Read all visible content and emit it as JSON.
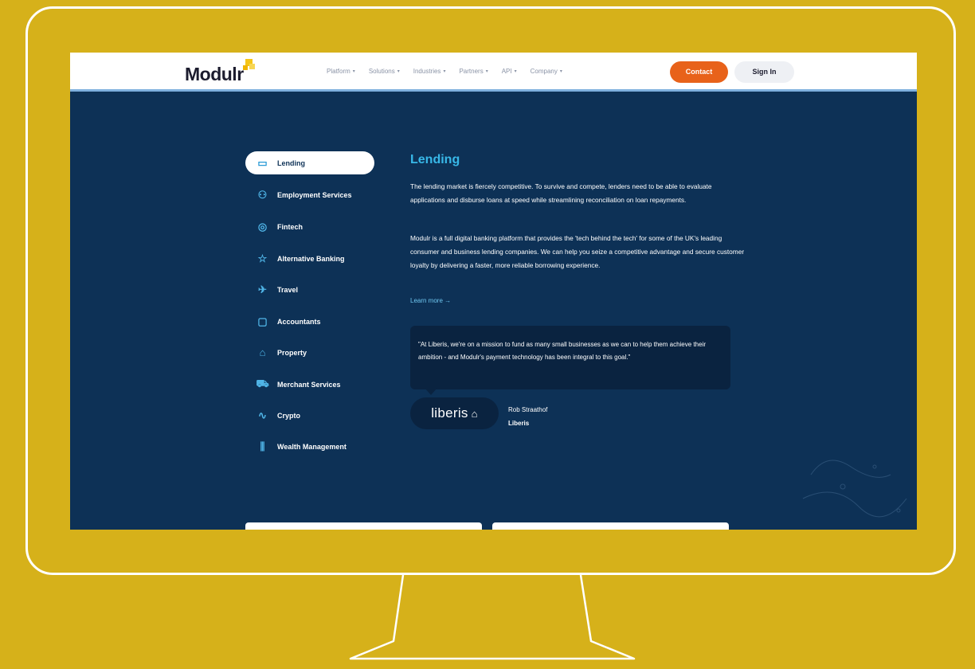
{
  "nav": {
    "logo_text": "Modulr",
    "menu": [
      {
        "label": "Platform"
      },
      {
        "label": "Solutions"
      },
      {
        "label": "Industries"
      },
      {
        "label": "Partners"
      },
      {
        "label": "API"
      },
      {
        "label": "Company"
      }
    ],
    "contact_label": "Contact",
    "signin_label": "Sign In"
  },
  "sidebar": {
    "items": [
      {
        "label": "Lending",
        "icon": "card-icon",
        "glyph": "▭",
        "active": true
      },
      {
        "label": "Employment Services",
        "icon": "person-icon",
        "glyph": "⚇"
      },
      {
        "label": "Fintech",
        "icon": "globe-icon",
        "glyph": "◎"
      },
      {
        "label": "Alternative Banking",
        "icon": "star-icon",
        "glyph": "☆"
      },
      {
        "label": "Travel",
        "icon": "plane-icon",
        "glyph": "✈"
      },
      {
        "label": "Accountants",
        "icon": "tablet-icon",
        "glyph": "▢"
      },
      {
        "label": "Property",
        "icon": "home-icon",
        "glyph": "⌂"
      },
      {
        "label": "Merchant Services",
        "icon": "cart-icon",
        "glyph": "⛟"
      },
      {
        "label": "Crypto",
        "icon": "pulse-icon",
        "glyph": "∿"
      },
      {
        "label": "Wealth Management",
        "icon": "sliders-icon",
        "glyph": "⫼"
      }
    ]
  },
  "content": {
    "title": "Lending",
    "para1": "The lending market is fiercely competitive. To survive and compete, lenders need to be able to evaluate applications and disburse loans at speed while streamlining reconciliation on loan repayments.",
    "para2": "Modulr is a full digital banking platform that provides the 'tech behind the tech' for some of the UK's leading consumer and business lending companies. We can help you seize a competitive advantage and secure customer loyalty by delivering a faster, more reliable borrowing experience.",
    "learn_more": "Learn more →",
    "quote": "\"At Liberis, we're on a mission to fund as many small businesses as we can to help them achieve their ambition - and Modulr's payment technology has been integral to this goal.\"",
    "partner_logo": "liberis",
    "author_name": "Rob Straathof",
    "author_company": "Liberis"
  },
  "colors": {
    "background": "#d6b11a",
    "screen_bg": "#0d3156",
    "accent": "#e8621a",
    "title": "#38b8e8"
  }
}
